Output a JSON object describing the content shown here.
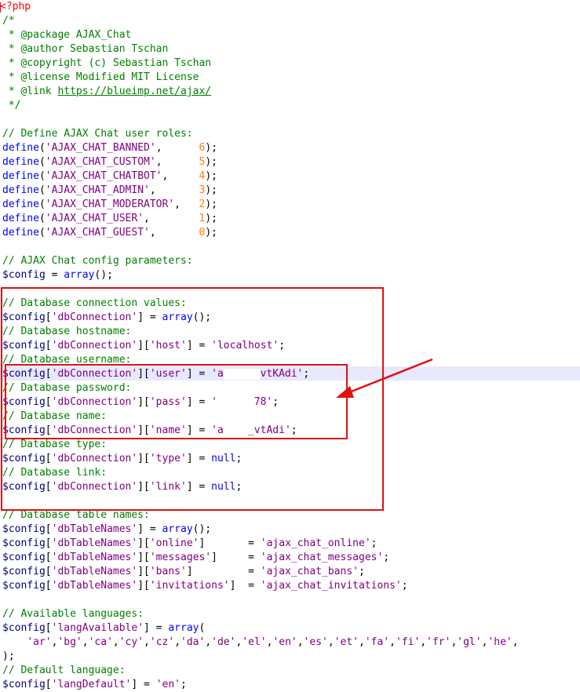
{
  "colors": {
    "comment": "#008000",
    "keyword": "#0000ff",
    "string": "#800080",
    "number": "#ff8000",
    "variable": "#000080",
    "tag": "#ff0000",
    "annotation": "#e01010",
    "line_highlight": "#e8e8ff"
  },
  "lines": [
    [
      {
        "t": "tag",
        "s": "<?php"
      }
    ],
    [
      {
        "t": "comment",
        "s": "/*"
      }
    ],
    [
      {
        "t": "comment",
        "s": " * @package AJAX_Chat"
      }
    ],
    [
      {
        "t": "comment",
        "s": " * @author Sebastian Tschan"
      }
    ],
    [
      {
        "t": "comment",
        "s": " * @copyright (c) Sebastian Tschan"
      }
    ],
    [
      {
        "t": "comment",
        "s": " * @license Modified MIT License"
      }
    ],
    [
      {
        "t": "comment",
        "s": " * @link "
      },
      {
        "t": "link",
        "s": "https://blueimp.net/ajax/"
      }
    ],
    [
      {
        "t": "comment",
        "s": " */"
      }
    ],
    [],
    [
      {
        "t": "comment",
        "s": "// Define AJAX Chat user roles:"
      }
    ],
    [
      {
        "t": "keyword",
        "s": "define"
      },
      {
        "t": "plain",
        "s": "("
      },
      {
        "t": "string",
        "s": "'AJAX_CHAT_BANNED'"
      },
      {
        "t": "plain",
        "s": ",      "
      },
      {
        "t": "number",
        "s": "6"
      },
      {
        "t": "plain",
        "s": ");"
      }
    ],
    [
      {
        "t": "keyword",
        "s": "define"
      },
      {
        "t": "plain",
        "s": "("
      },
      {
        "t": "string",
        "s": "'AJAX_CHAT_CUSTOM'"
      },
      {
        "t": "plain",
        "s": ",      "
      },
      {
        "t": "number",
        "s": "5"
      },
      {
        "t": "plain",
        "s": ");"
      }
    ],
    [
      {
        "t": "keyword",
        "s": "define"
      },
      {
        "t": "plain",
        "s": "("
      },
      {
        "t": "string",
        "s": "'AJAX_CHAT_CHATBOT'"
      },
      {
        "t": "plain",
        "s": ",     "
      },
      {
        "t": "number",
        "s": "4"
      },
      {
        "t": "plain",
        "s": ");"
      }
    ],
    [
      {
        "t": "keyword",
        "s": "define"
      },
      {
        "t": "plain",
        "s": "("
      },
      {
        "t": "string",
        "s": "'AJAX_CHAT_ADMIN'"
      },
      {
        "t": "plain",
        "s": ",       "
      },
      {
        "t": "number",
        "s": "3"
      },
      {
        "t": "plain",
        "s": ");"
      }
    ],
    [
      {
        "t": "keyword",
        "s": "define"
      },
      {
        "t": "plain",
        "s": "("
      },
      {
        "t": "string",
        "s": "'AJAX_CHAT_MODERATOR'"
      },
      {
        "t": "plain",
        "s": ",   "
      },
      {
        "t": "number",
        "s": "2"
      },
      {
        "t": "plain",
        "s": ");"
      }
    ],
    [
      {
        "t": "keyword",
        "s": "define"
      },
      {
        "t": "plain",
        "s": "("
      },
      {
        "t": "string",
        "s": "'AJAX_CHAT_USER'"
      },
      {
        "t": "plain",
        "s": ",        "
      },
      {
        "t": "number",
        "s": "1"
      },
      {
        "t": "plain",
        "s": ");"
      }
    ],
    [
      {
        "t": "keyword",
        "s": "define"
      },
      {
        "t": "plain",
        "s": "("
      },
      {
        "t": "string",
        "s": "'AJAX_CHAT_GUEST'"
      },
      {
        "t": "plain",
        "s": ",       "
      },
      {
        "t": "number",
        "s": "0"
      },
      {
        "t": "plain",
        "s": ");"
      }
    ],
    [],
    [
      {
        "t": "comment",
        "s": "// AJAX Chat config parameters:"
      }
    ],
    [
      {
        "t": "var",
        "s": "$config"
      },
      {
        "t": "plain",
        "s": " = "
      },
      {
        "t": "keyword",
        "s": "array"
      },
      {
        "t": "plain",
        "s": "();"
      }
    ],
    [],
    [
      {
        "t": "comment",
        "s": "// Database connection values:"
      }
    ],
    [
      {
        "t": "var",
        "s": "$config"
      },
      {
        "t": "plain",
        "s": "["
      },
      {
        "t": "string",
        "s": "'dbConnection'"
      },
      {
        "t": "plain",
        "s": "] = "
      },
      {
        "t": "keyword",
        "s": "array"
      },
      {
        "t": "plain",
        "s": "();"
      }
    ],
    [
      {
        "t": "comment",
        "s": "// Database hostname:"
      }
    ],
    [
      {
        "t": "var",
        "s": "$config"
      },
      {
        "t": "plain",
        "s": "["
      },
      {
        "t": "string",
        "s": "'dbConnection'"
      },
      {
        "t": "plain",
        "s": "]["
      },
      {
        "t": "string",
        "s": "'host'"
      },
      {
        "t": "plain",
        "s": "] = "
      },
      {
        "t": "string",
        "s": "'localhost'"
      },
      {
        "t": "plain",
        "s": ";"
      }
    ],
    [
      {
        "t": "comment",
        "s": "// Database username:"
      }
    ],
    [
      {
        "t": "var",
        "s": "$config"
      },
      {
        "t": "plain",
        "s": "["
      },
      {
        "t": "string",
        "s": "'dbConnection'"
      },
      {
        "t": "plain",
        "s": "]["
      },
      {
        "t": "string",
        "s": "'user'"
      },
      {
        "t": "plain",
        "s": "] = "
      },
      {
        "t": "string",
        "s": "'a"
      },
      {
        "t": "redact",
        "w": 6
      },
      {
        "t": "string",
        "s": "vtKAdi'"
      },
      {
        "t": "plain",
        "s": ";"
      }
    ],
    [
      {
        "t": "comment",
        "s": "// Database password:"
      }
    ],
    [
      {
        "t": "var",
        "s": "$config"
      },
      {
        "t": "plain",
        "s": "["
      },
      {
        "t": "string",
        "s": "'dbConnection'"
      },
      {
        "t": "plain",
        "s": "]["
      },
      {
        "t": "string",
        "s": "'pass'"
      },
      {
        "t": "plain",
        "s": "] = "
      },
      {
        "t": "string",
        "s": "'"
      },
      {
        "t": "redact",
        "w": 6
      },
      {
        "t": "string",
        "s": "78'"
      },
      {
        "t": "plain",
        "s": ";"
      }
    ],
    [
      {
        "t": "comment",
        "s": "// Database name:"
      }
    ],
    [
      {
        "t": "var",
        "s": "$config"
      },
      {
        "t": "plain",
        "s": "["
      },
      {
        "t": "string",
        "s": "'dbConnection'"
      },
      {
        "t": "plain",
        "s": "]["
      },
      {
        "t": "string",
        "s": "'name'"
      },
      {
        "t": "plain",
        "s": "] = "
      },
      {
        "t": "string",
        "s": "'a"
      },
      {
        "t": "redact",
        "w": 4
      },
      {
        "t": "string",
        "s": "_vtAdi'"
      },
      {
        "t": "plain",
        "s": ";"
      }
    ],
    [
      {
        "t": "comment",
        "s": "// Database type:"
      }
    ],
    [
      {
        "t": "var",
        "s": "$config"
      },
      {
        "t": "plain",
        "s": "["
      },
      {
        "t": "string",
        "s": "'dbConnection'"
      },
      {
        "t": "plain",
        "s": "]["
      },
      {
        "t": "string",
        "s": "'type'"
      },
      {
        "t": "plain",
        "s": "] = "
      },
      {
        "t": "keyword",
        "s": "null"
      },
      {
        "t": "plain",
        "s": ";"
      }
    ],
    [
      {
        "t": "comment",
        "s": "// Database link:"
      }
    ],
    [
      {
        "t": "var",
        "s": "$config"
      },
      {
        "t": "plain",
        "s": "["
      },
      {
        "t": "string",
        "s": "'dbConnection'"
      },
      {
        "t": "plain",
        "s": "]["
      },
      {
        "t": "string",
        "s": "'link'"
      },
      {
        "t": "plain",
        "s": "] = "
      },
      {
        "t": "keyword",
        "s": "null"
      },
      {
        "t": "plain",
        "s": ";"
      }
    ],
    [],
    [
      {
        "t": "comment",
        "s": "// Database table names:"
      }
    ],
    [
      {
        "t": "var",
        "s": "$config"
      },
      {
        "t": "plain",
        "s": "["
      },
      {
        "t": "string",
        "s": "'dbTableNames'"
      },
      {
        "t": "plain",
        "s": "] = "
      },
      {
        "t": "keyword",
        "s": "array"
      },
      {
        "t": "plain",
        "s": "();"
      }
    ],
    [
      {
        "t": "var",
        "s": "$config"
      },
      {
        "t": "plain",
        "s": "["
      },
      {
        "t": "string",
        "s": "'dbTableNames'"
      },
      {
        "t": "plain",
        "s": "]["
      },
      {
        "t": "string",
        "s": "'online'"
      },
      {
        "t": "plain",
        "s": "]       = "
      },
      {
        "t": "string",
        "s": "'ajax_chat_online'"
      },
      {
        "t": "plain",
        "s": ";"
      }
    ],
    [
      {
        "t": "var",
        "s": "$config"
      },
      {
        "t": "plain",
        "s": "["
      },
      {
        "t": "string",
        "s": "'dbTableNames'"
      },
      {
        "t": "plain",
        "s": "]["
      },
      {
        "t": "string",
        "s": "'messages'"
      },
      {
        "t": "plain",
        "s": "]     = "
      },
      {
        "t": "string",
        "s": "'ajax_chat_messages'"
      },
      {
        "t": "plain",
        "s": ";"
      }
    ],
    [
      {
        "t": "var",
        "s": "$config"
      },
      {
        "t": "plain",
        "s": "["
      },
      {
        "t": "string",
        "s": "'dbTableNames'"
      },
      {
        "t": "plain",
        "s": "]["
      },
      {
        "t": "string",
        "s": "'bans'"
      },
      {
        "t": "plain",
        "s": "]         = "
      },
      {
        "t": "string",
        "s": "'ajax_chat_bans'"
      },
      {
        "t": "plain",
        "s": ";"
      }
    ],
    [
      {
        "t": "var",
        "s": "$config"
      },
      {
        "t": "plain",
        "s": "["
      },
      {
        "t": "string",
        "s": "'dbTableNames'"
      },
      {
        "t": "plain",
        "s": "]["
      },
      {
        "t": "string",
        "s": "'invitations'"
      },
      {
        "t": "plain",
        "s": "]  = "
      },
      {
        "t": "string",
        "s": "'ajax_chat_invitations'"
      },
      {
        "t": "plain",
        "s": ";"
      }
    ],
    [],
    [
      {
        "t": "comment",
        "s": "// Available languages:"
      }
    ],
    [
      {
        "t": "var",
        "s": "$config"
      },
      {
        "t": "plain",
        "s": "["
      },
      {
        "t": "string",
        "s": "'langAvailable'"
      },
      {
        "t": "plain",
        "s": "] = "
      },
      {
        "t": "keyword",
        "s": "array"
      },
      {
        "t": "plain",
        "s": "("
      }
    ],
    [
      {
        "t": "plain",
        "s": "    "
      },
      {
        "t": "string",
        "s": "'ar'"
      },
      {
        "t": "plain",
        "s": ","
      },
      {
        "t": "string",
        "s": "'bg'"
      },
      {
        "t": "plain",
        "s": ","
      },
      {
        "t": "string",
        "s": "'ca'"
      },
      {
        "t": "plain",
        "s": ","
      },
      {
        "t": "string",
        "s": "'cy'"
      },
      {
        "t": "plain",
        "s": ","
      },
      {
        "t": "string",
        "s": "'cz'"
      },
      {
        "t": "plain",
        "s": ","
      },
      {
        "t": "string",
        "s": "'da'"
      },
      {
        "t": "plain",
        "s": ","
      },
      {
        "t": "string",
        "s": "'de'"
      },
      {
        "t": "plain",
        "s": ","
      },
      {
        "t": "string",
        "s": "'el'"
      },
      {
        "t": "plain",
        "s": ","
      },
      {
        "t": "string",
        "s": "'en'"
      },
      {
        "t": "plain",
        "s": ","
      },
      {
        "t": "string",
        "s": "'es'"
      },
      {
        "t": "plain",
        "s": ","
      },
      {
        "t": "string",
        "s": "'et'"
      },
      {
        "t": "plain",
        "s": ","
      },
      {
        "t": "string",
        "s": "'fa'"
      },
      {
        "t": "plain",
        "s": ","
      },
      {
        "t": "string",
        "s": "'fi'"
      },
      {
        "t": "plain",
        "s": ","
      },
      {
        "t": "string",
        "s": "'fr'"
      },
      {
        "t": "plain",
        "s": ","
      },
      {
        "t": "string",
        "s": "'gl'"
      },
      {
        "t": "plain",
        "s": ","
      },
      {
        "t": "string",
        "s": "'he'"
      },
      {
        "t": "plain",
        "s": ","
      }
    ],
    [
      {
        "t": "plain",
        "s": ");"
      }
    ],
    [
      {
        "t": "comment",
        "s": "// Default language:"
      }
    ],
    [
      {
        "t": "var",
        "s": "$config"
      },
      {
        "t": "plain",
        "s": "["
      },
      {
        "t": "string",
        "s": "'langDefault'"
      },
      {
        "t": "plain",
        "s": "] = "
      },
      {
        "t": "string",
        "s": "'en'"
      },
      {
        "t": "plain",
        "s": ";"
      }
    ]
  ]
}
